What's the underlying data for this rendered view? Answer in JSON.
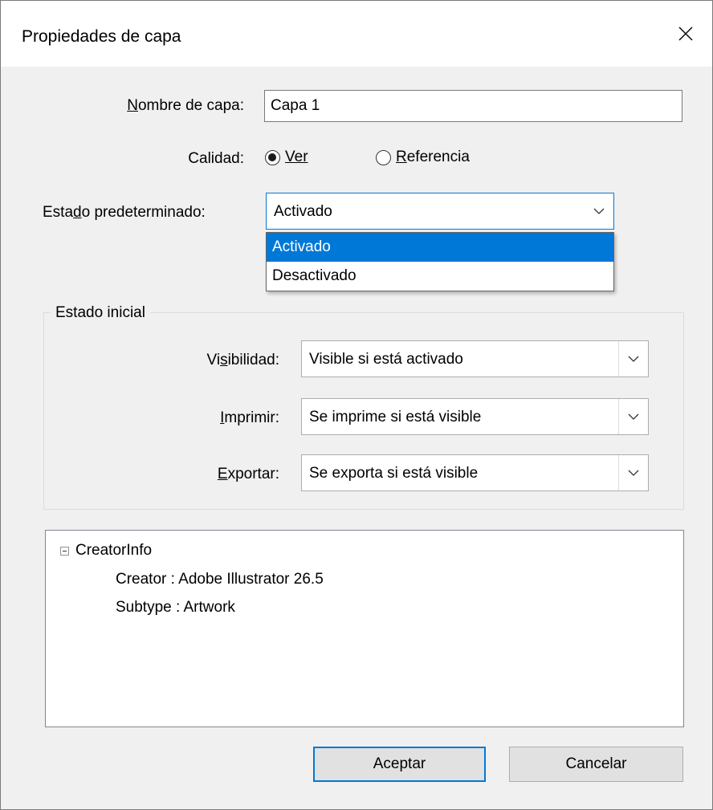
{
  "dialog": {
    "title": "Propiedades de capa"
  },
  "name_field": {
    "label": "Nombre de capa:",
    "value": "Capa 1"
  },
  "quality": {
    "label": "Calidad:",
    "options": [
      {
        "label": "Ver",
        "selected": true
      },
      {
        "label": "Referencia",
        "selected": false
      }
    ]
  },
  "default_state": {
    "label": "Estado predeterminado:",
    "value": "Activado",
    "dropdown_options": [
      "Activado",
      "Desactivado"
    ],
    "highlighted_option": "Activado"
  },
  "initial_state": {
    "title": "Estado inicial",
    "visibility": {
      "label": "Visibilidad:",
      "value": "Visible si está activado"
    },
    "print": {
      "label": "Imprimir:",
      "value": "Se imprime si está visible"
    },
    "export": {
      "label": "Exportar:",
      "value": "Se exporta si está visible"
    }
  },
  "info_tree": {
    "root": "CreatorInfo",
    "children": [
      "Creator : Adobe Illustrator 26.5",
      "Subtype : Artwork"
    ]
  },
  "buttons": {
    "ok": "Aceptar",
    "cancel": "Cancelar"
  },
  "colors": {
    "accent": "#0078d7",
    "background": "#f0f0f0"
  },
  "icons": {
    "close": "close-icon",
    "dropdown": "chevron-down-icon",
    "collapse": "tree-collapse-icon"
  }
}
